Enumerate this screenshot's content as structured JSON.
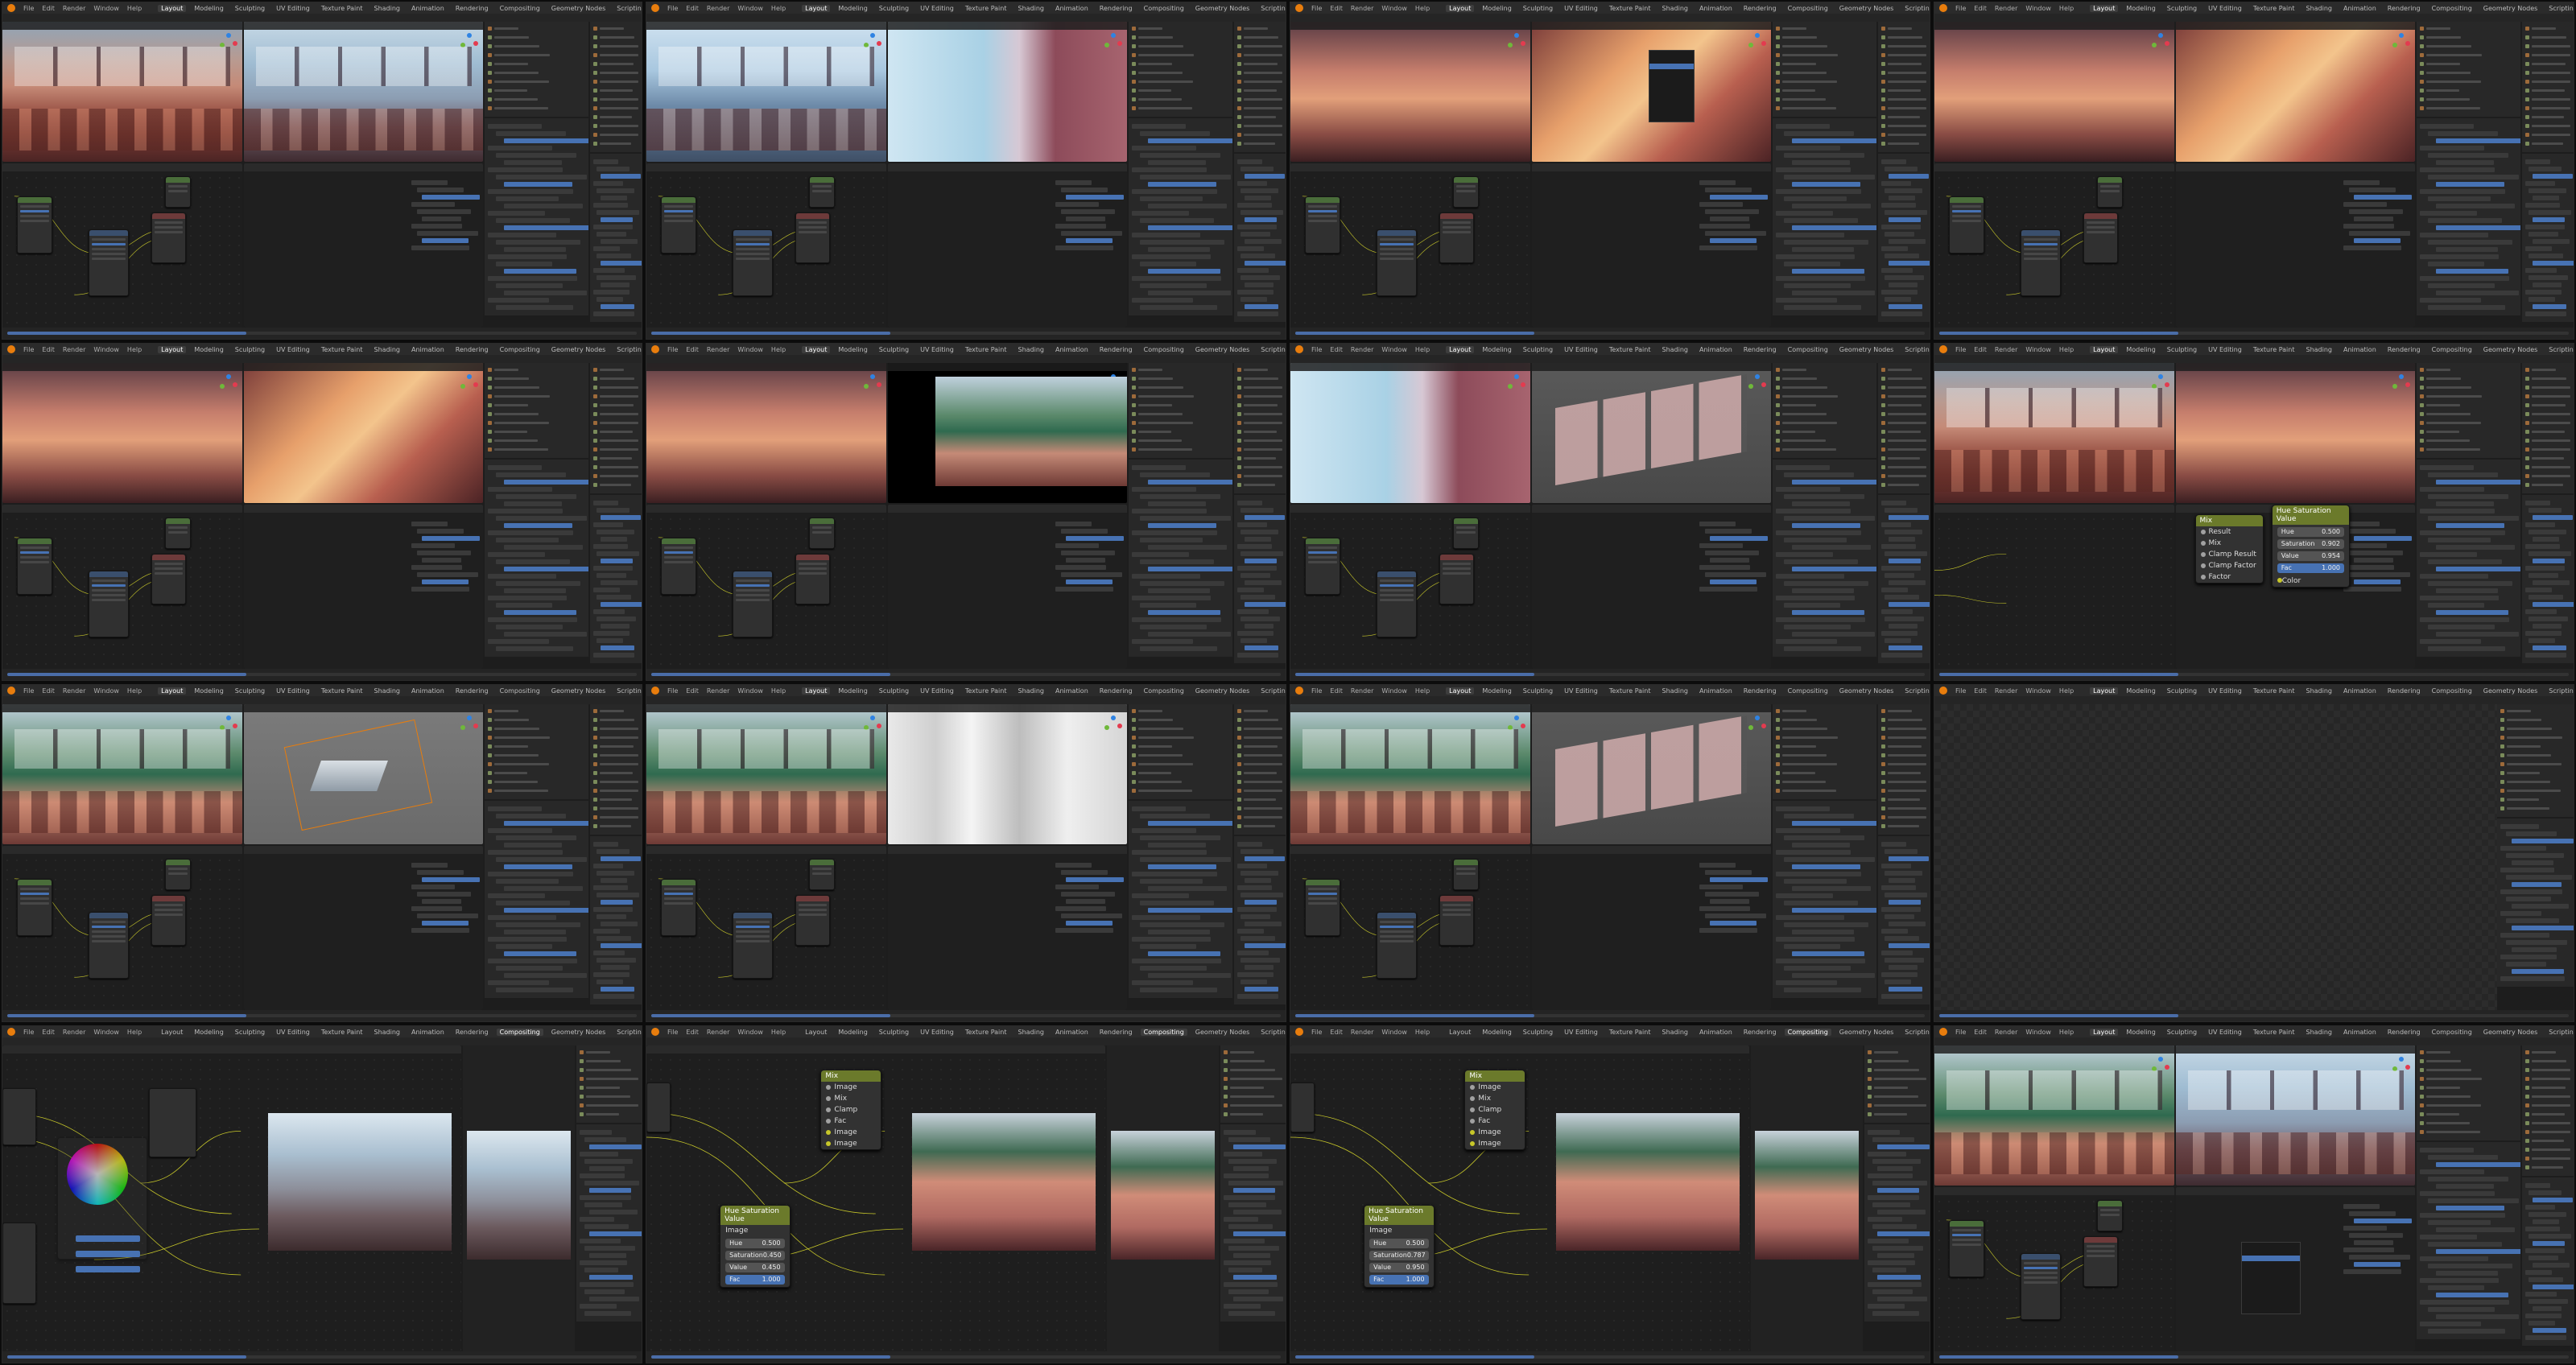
{
  "app": {
    "menu": [
      "File",
      "Edit",
      "Render",
      "Window",
      "Help"
    ],
    "workspaces": [
      "Layout",
      "Modeling",
      "Sculpting",
      "UV Editing",
      "Texture Paint",
      "Shading",
      "Animation",
      "Rendering",
      "Compositing",
      "Geometry Nodes",
      "Scripting"
    ],
    "active_workspace_default": "Layout",
    "active_workspace_compositing": "Compositing"
  },
  "node_labels": {
    "hue_saturation_value": "Hue Saturation Value",
    "mix": "Mix",
    "image": "Image",
    "fac": "Fac",
    "clamp": "Clamp",
    "hue": "Hue",
    "saturation": "Saturation",
    "value": "Value",
    "color": "Color",
    "clamp_result": "Clamp Result",
    "clamp_factor": "Clamp Factor",
    "factor": "Factor",
    "result": "Result"
  },
  "node_values": {
    "frame8": {
      "hue": "0.500",
      "saturation": "0.902",
      "value": "0.954",
      "fac": "1.000"
    },
    "frame14": {
      "hue": "0.500",
      "saturation": "0.450",
      "value": "0.450",
      "fac": "1.000"
    },
    "frame15": {
      "hue": "0.500",
      "saturation": "0.787",
      "value": "0.950",
      "fac": "1.000"
    }
  },
  "colors": {
    "accent_blue": "#4772b3",
    "header_green": "#6b7a2b",
    "socket_yellow": "#c7c729",
    "blender_orange": "#e87d0d"
  },
  "icons": [
    "blender-logo-icon",
    "axis-gizmo-icon",
    "color-wheel-icon"
  ]
}
